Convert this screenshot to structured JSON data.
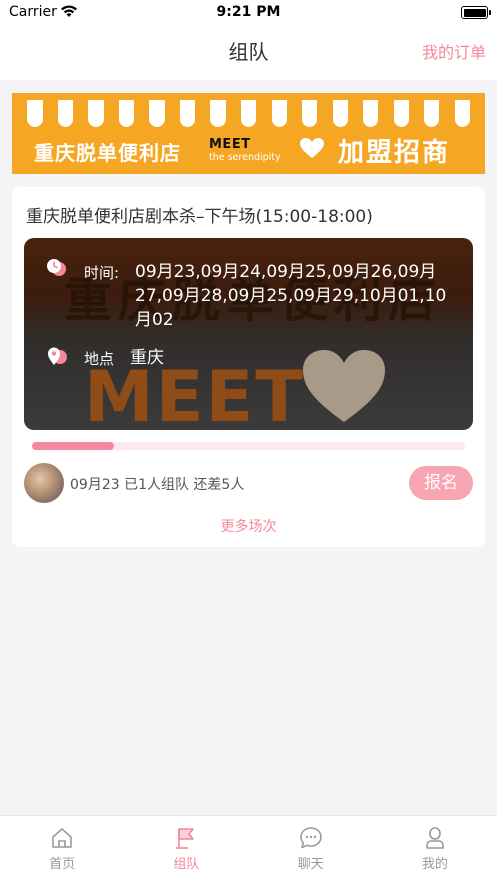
{
  "status_bar": {
    "carrier": "Carrier",
    "time": "9:21 PM"
  },
  "nav": {
    "title": "组队",
    "right_link": "我的订单"
  },
  "banner": {
    "left_text": "重庆脱单便利店",
    "meet": "MEET",
    "meet_sub": "the serendipity",
    "right_text": "加盟招商",
    "background_color": "#f5a623"
  },
  "card": {
    "title": "重庆脱单便利店剧本杀–下午场(15:00-18:00)",
    "photo_sign_top": "重庆脱单便利店",
    "photo_sign_meet": "MEET",
    "time_label": "时间:",
    "time_value": "09月23,09月24,09月25,09月26,09月27,09月28,09月25,09月29,10月01,10月02",
    "location_label": "地点",
    "location_value": "重庆",
    "progress_fraction": 0.19,
    "session_text": "09月23  已1人组队  还差5人",
    "signup_label": "报名",
    "more_label": "更多场次"
  },
  "tabs": [
    {
      "label": "首页",
      "icon": "home-icon",
      "active": false
    },
    {
      "label": "组队",
      "icon": "team-flag-icon",
      "active": true
    },
    {
      "label": "聊天",
      "icon": "chat-icon",
      "active": false
    },
    {
      "label": "我的",
      "icon": "profile-icon",
      "active": false
    }
  ],
  "colors": {
    "accent": "#f5879b",
    "button": "#f7a5b0",
    "progress_track": "#fde8ec"
  }
}
